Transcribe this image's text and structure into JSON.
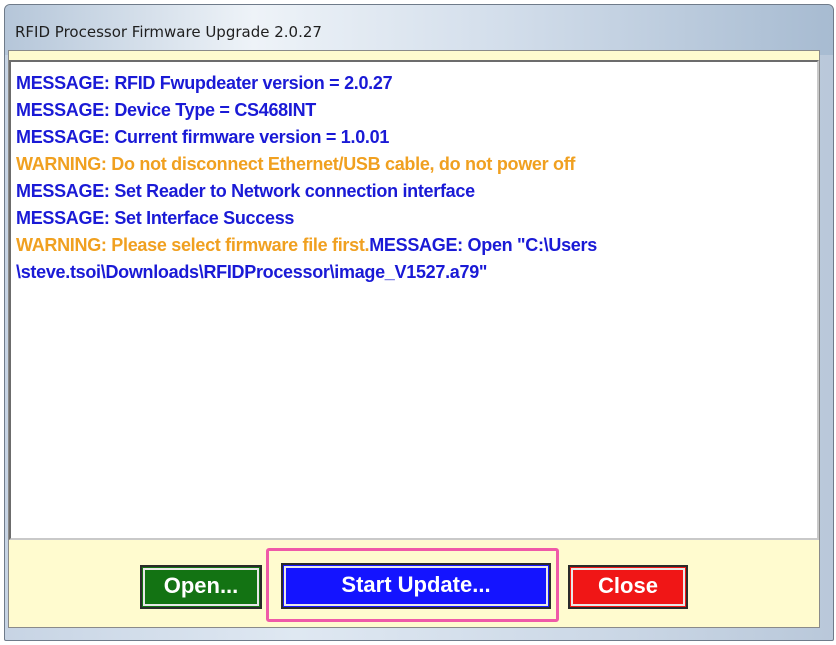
{
  "window": {
    "title": "RFID Processor Firmware Upgrade 2.0.27"
  },
  "log": {
    "lines": [
      {
        "type": "message",
        "text": "MESSAGE: RFID Fwupdeater version = 2.0.27"
      },
      {
        "type": "message",
        "text": "MESSAGE: Device Type = CS468INT"
      },
      {
        "type": "message",
        "text": "MESSAGE: Current firmware version = 1.0.01"
      },
      {
        "type": "warning",
        "text": "WARNING: Do not disconnect Ethernet/USB cable, do not power off"
      },
      {
        "type": "message",
        "text": "MESSAGE: Set Reader to Network connection interface"
      },
      {
        "type": "message",
        "text": "MESSAGE: Set Interface Success"
      },
      {
        "type": "mixed",
        "warning_part": "WARNING: Please select firmware file first.",
        "message_part": "MESSAGE: Open \"C:\\Users"
      },
      {
        "type": "message",
        "text": "\\steve.tsoi\\Downloads\\RFIDProcessor\\image_V1527.a79\""
      }
    ]
  },
  "buttons": {
    "open_label": "Open...",
    "start_update_label": "Start Update...",
    "close_label": "Close"
  },
  "colors": {
    "message": "#1a1ad6",
    "warning": "#f0a020",
    "open_button": "#137313",
    "start_update_button": "#1414ff",
    "close_button": "#f01616",
    "panel_background": "#fffbcf",
    "highlight_border": "#ef5aa8"
  }
}
